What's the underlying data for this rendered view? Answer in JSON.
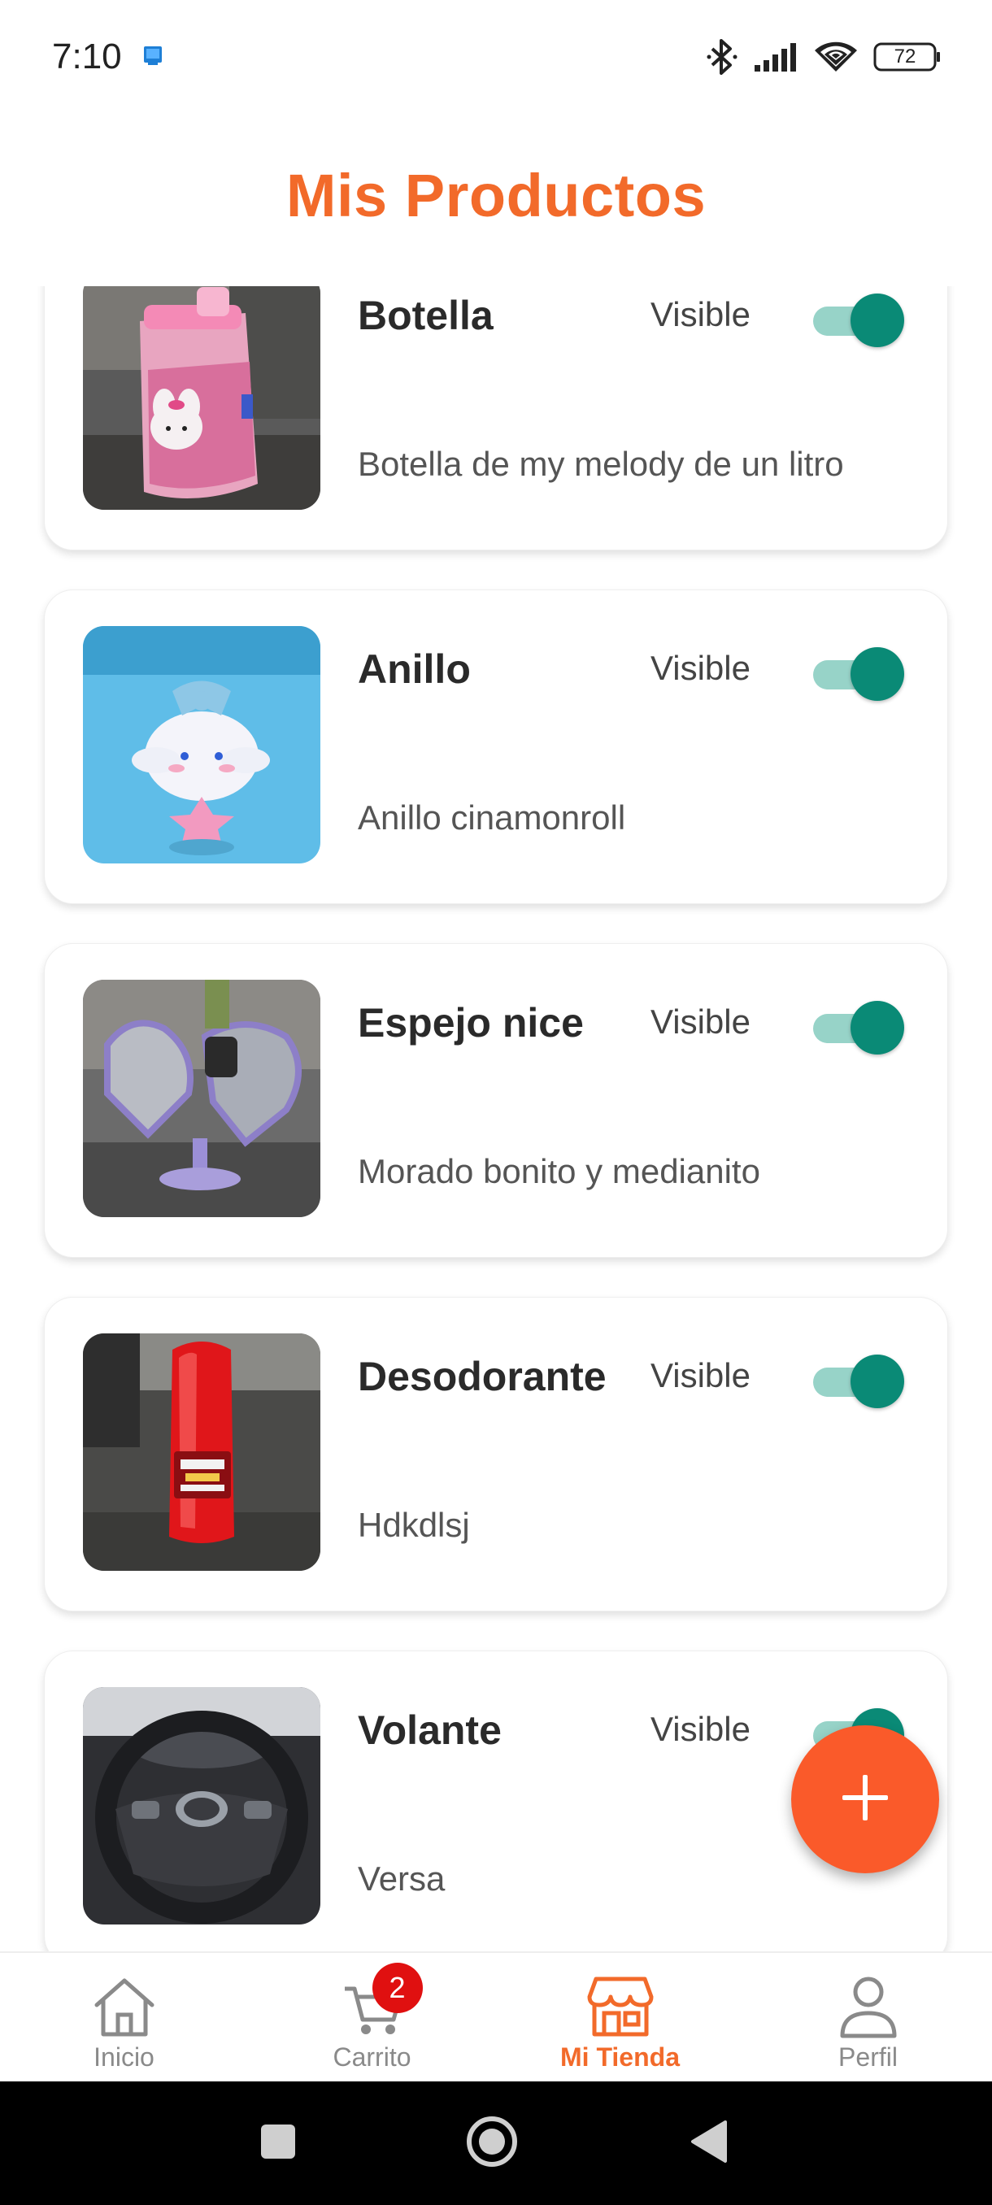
{
  "status_bar": {
    "time": "7:10",
    "battery": "72",
    "icons": [
      "app-notification-icon",
      "bluetooth-icon",
      "signal-icon",
      "wifi-icon",
      "battery-icon"
    ]
  },
  "header": {
    "title": "Mis Productos"
  },
  "products": [
    {
      "name": "Botella",
      "visibility_label": "Visible",
      "visible": true,
      "description": "Botella de my melody de un litro"
    },
    {
      "name": "Anillo",
      "visibility_label": "Visible",
      "visible": true,
      "description": "Anillo cinamonroll"
    },
    {
      "name": "Espejo nice",
      "visibility_label": "Visible",
      "visible": true,
      "description": "Morado bonito y medianito"
    },
    {
      "name": "Desodorante",
      "visibility_label": "Visible",
      "visible": true,
      "description": "Hdkdlsj"
    },
    {
      "name": "Volante",
      "visibility_label": "Visible",
      "visible": true,
      "description": "Versa"
    }
  ],
  "fab": {
    "icon": "plus-icon"
  },
  "bottom_nav": {
    "items": [
      {
        "label": "Inicio",
        "icon": "home-icon",
        "active": false
      },
      {
        "label": "Carrito",
        "icon": "cart-icon",
        "active": false,
        "badge": "2"
      },
      {
        "label": "Mi Tienda",
        "icon": "store-icon",
        "active": true
      },
      {
        "label": "Perfil",
        "icon": "person-icon",
        "active": false
      }
    ]
  },
  "colors": {
    "accent": "#f26a2a",
    "fab": "#fa5a2a",
    "toggle_knob": "#0a8a76",
    "toggle_track": "#97d3c8",
    "badge": "#e01010"
  }
}
